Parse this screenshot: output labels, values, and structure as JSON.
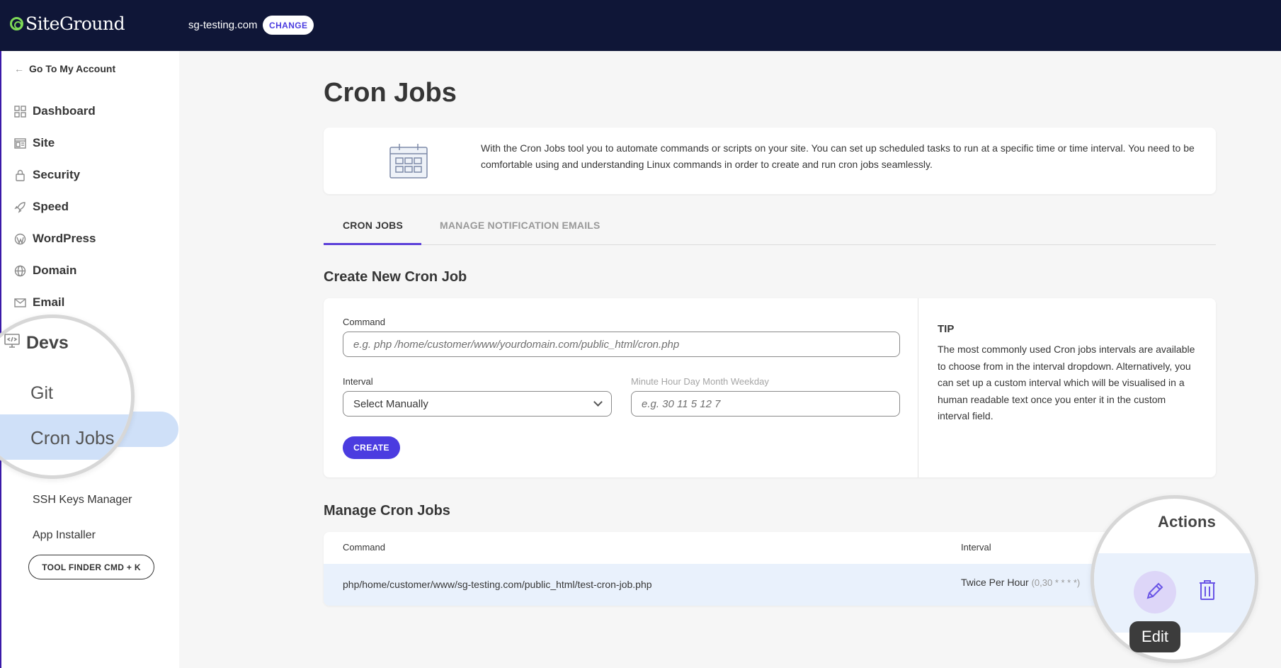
{
  "header": {
    "brand": "SiteGround",
    "site_name": "sg-testing.com",
    "change_label": "CHANGE"
  },
  "sidebar": {
    "back_label": "Go To My Account",
    "items": [
      {
        "label": "Dashboard",
        "icon": "grid-icon"
      },
      {
        "label": "Site",
        "icon": "site-icon"
      },
      {
        "label": "Security",
        "icon": "lock-icon"
      },
      {
        "label": "Speed",
        "icon": "rocket-icon"
      },
      {
        "label": "WordPress",
        "icon": "wordpress-icon"
      },
      {
        "label": "Domain",
        "icon": "globe-icon"
      },
      {
        "label": "Email",
        "icon": "envelope-icon"
      }
    ],
    "devs": {
      "label": "Devs",
      "icon": "code-monitor-icon",
      "sub_items": [
        "Git",
        "Cron Jobs",
        "SSH Keys Manager",
        "App Installer"
      ],
      "active": "Cron Jobs"
    },
    "tool_finder_label": "TOOL FINDER CMD + K"
  },
  "main": {
    "title": "Cron Jobs",
    "info_text": "With the Cron Jobs tool you to automate commands or scripts on your site. You can set up scheduled tasks to run at a specific time or time interval. You need to be comfortable using and understanding Linux commands in order to create and run cron jobs seamlessly.",
    "tabs": [
      {
        "label": "CRON JOBS",
        "active": true
      },
      {
        "label": "MANAGE NOTIFICATION EMAILS",
        "active": false
      }
    ],
    "create": {
      "title": "Create New Cron Job",
      "command_label": "Command",
      "command_placeholder": "e.g. php /home/customer/www/yourdomain.com/public_html/cron.php",
      "interval_label": "Interval",
      "interval_value": "Select Manually",
      "custom_label": "Minute Hour Day Month Weekday",
      "custom_placeholder": "e.g. 30 11 5 12 7",
      "create_label": "CREATE",
      "tip_title": "TIP",
      "tip_text": "The most commonly used Cron jobs intervals are available to choose from in the interval dropdown. Alternatively, you can set up a custom interval which will be visualised in a human readable text once you enter it in the custom interval field."
    },
    "manage": {
      "title": "Manage Cron Jobs",
      "columns": {
        "command": "Command",
        "interval": "Interval",
        "actions": "Actions"
      },
      "rows": [
        {
          "command": "php/home/customer/www/sg-testing.com/public_html/test-cron-job.php",
          "interval": "Twice Per Hour",
          "interval_expr": "(0,30 * * * *)"
        }
      ],
      "edit_tooltip": "Edit"
    }
  },
  "colors": {
    "topbar": "#0f1637",
    "accent": "#4b3ce0",
    "active_bg": "#cfe0f8",
    "row_bg": "#e9f1fc"
  }
}
